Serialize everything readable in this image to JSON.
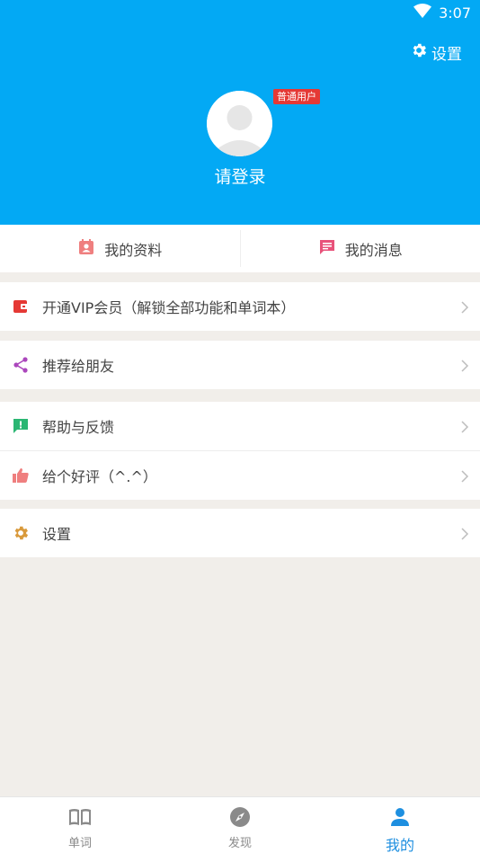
{
  "status_bar": {
    "time": "3:07"
  },
  "header": {
    "settings_label": "设置",
    "badge": "普通用户",
    "login_label": "请登录"
  },
  "quick_tabs": [
    {
      "label": "我的资料",
      "icon": "profile-card-icon",
      "color": "#ef7f7f"
    },
    {
      "label": "我的消息",
      "icon": "message-icon",
      "color": "#e8527a"
    }
  ],
  "menu": {
    "vip": {
      "label": "开通VIP会员（解锁全部功能和单词本）",
      "icon": "wallet-icon",
      "color": "#e53935"
    },
    "share": {
      "label": "推荐给朋友",
      "icon": "share-icon",
      "color": "#ab47bc"
    },
    "feedback": {
      "label": "帮助与反馈",
      "icon": "feedback-icon",
      "color": "#2bb673"
    },
    "rate": {
      "label": "给个好评（^.^）",
      "icon": "thumbs-up-icon",
      "color": "#ef7f7f"
    },
    "settings": {
      "label": "设置",
      "icon": "gear-icon",
      "color": "#d99a3c"
    }
  },
  "bottom_nav": [
    {
      "label": "单词",
      "icon": "book-icon",
      "active": false
    },
    {
      "label": "发现",
      "icon": "compass-icon",
      "active": false
    },
    {
      "label": "我的",
      "icon": "person-icon",
      "active": true
    }
  ],
  "colors": {
    "accent": "#03a9f4",
    "nav_active": "#1e8fe0",
    "background": "#f1eeea"
  }
}
